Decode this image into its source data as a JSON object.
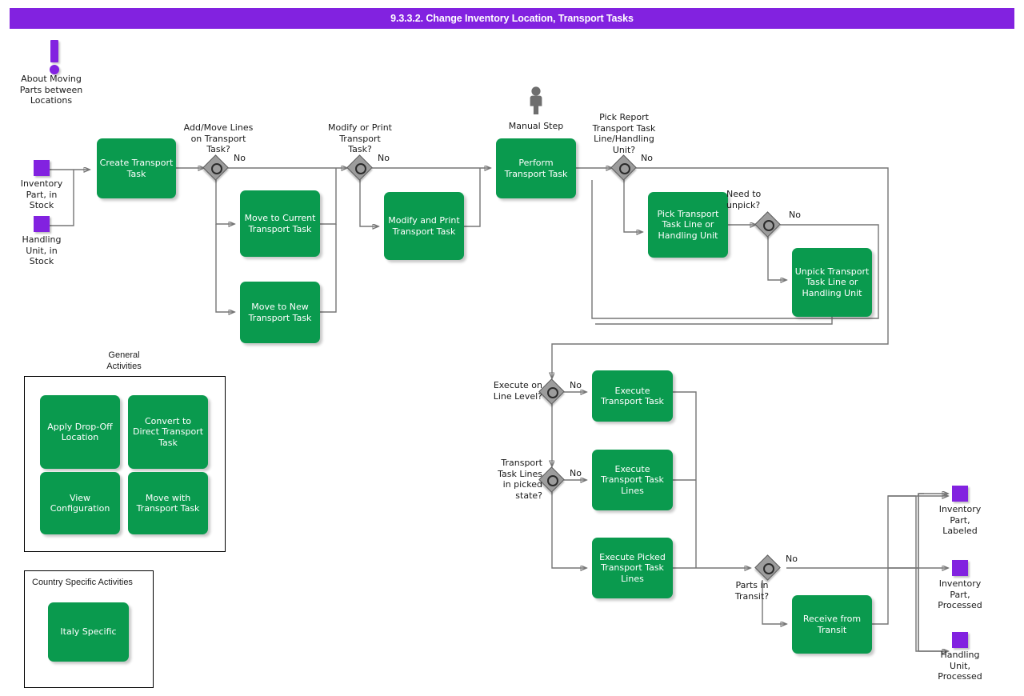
{
  "header": {
    "title": "9.3.3.2. Change Inventory Location, Transport Tasks",
    "background": "#8222e0",
    "text_color": "#ffffff"
  },
  "colors": {
    "activity": "#0a9a4e",
    "data_object": "#8222e0",
    "gateway": "#9c9c9c",
    "connector": "#767676",
    "accent": "#8222e0"
  },
  "annotations": {
    "info_marker": {
      "icon": "exclamation-icon",
      "label": "About Moving\nParts between\nLocations"
    },
    "manual_step": {
      "icon": "person-icon",
      "label": "Manual Step"
    }
  },
  "inputs": [
    {
      "icon": "data-object-icon",
      "label": "Inventory\nPart, in\nStock"
    },
    {
      "icon": "data-object-icon",
      "label": "Handling\nUnit, in\nStock"
    }
  ],
  "outputs": [
    {
      "icon": "data-object-icon",
      "label": "Inventory\nPart,\nLabeled"
    },
    {
      "icon": "data-object-icon",
      "label": "Inventory\nPart,\nProcessed"
    },
    {
      "icon": "data-object-icon",
      "label": "Handling\nUnit,\nProcessed"
    }
  ],
  "activities": [
    {
      "id": "create_transport_task",
      "label": "Create\nTransport Task"
    },
    {
      "id": "move_to_current",
      "label": "Move to\nCurrent\nTransport\nTask"
    },
    {
      "id": "move_to_new",
      "label": "Move to New\nTransport\nTask"
    },
    {
      "id": "modify_and_print",
      "label": "Modify and Print\nTransport Task"
    },
    {
      "id": "perform_transport_task",
      "label": "Perform\nTransport Task"
    },
    {
      "id": "pick_tt_line_or_hu",
      "label": "Pick Transport\nTask Line or\nHandling Unit"
    },
    {
      "id": "unpick_tt_line_or_hu",
      "label": "Unpick\nTransport Task\nLine or Handling\nUnit"
    },
    {
      "id": "execute_transport_task",
      "label": "Execute\nTransport Task"
    },
    {
      "id": "execute_transport_task_lines",
      "label": "Execute\nTransport Task\nLines"
    },
    {
      "id": "execute_picked_tt_lines",
      "label": "Execute Picked\nTransport Task\nLines"
    },
    {
      "id": "receive_from_transit",
      "label": "Receive from\nTransit"
    }
  ],
  "gateways": [
    {
      "id": "gw_add_move_lines",
      "question": "Add/Move Lines\non Transport\nTask?",
      "branch_label": "No"
    },
    {
      "id": "gw_modify_print",
      "question": "Modify or Print\nTransport\nTask?",
      "branch_label": "No"
    },
    {
      "id": "gw_pick_report",
      "question": "Pick Report\nTransport Task\nLine/Handling\nUnit?",
      "branch_label": "No"
    },
    {
      "id": "gw_need_unpick",
      "question": "Need to\nunpick?",
      "branch_label": "No"
    },
    {
      "id": "gw_execute_line",
      "question": "Execute on\nLine Level?",
      "branch_label": "No"
    },
    {
      "id": "gw_lines_picked",
      "question": "Transport\nTask Lines\nin picked\nstate?",
      "branch_label": "No"
    },
    {
      "id": "gw_parts_transit",
      "question": "Parts in\nTransit?",
      "branch_label": "No"
    }
  ],
  "groups": {
    "general": {
      "title": "General\nActivities",
      "items": [
        {
          "id": "apply_drop_off",
          "label": "Apply Drop-Off\nLocation"
        },
        {
          "id": "convert_to_direct",
          "label": "Convert to\nDirect Transport\nTask"
        },
        {
          "id": "view_configuration",
          "label": "View\nConfiguration"
        },
        {
          "id": "move_with_tt",
          "label": "Move with\nTransport Task"
        }
      ]
    },
    "country": {
      "title": "Country Specific Activities",
      "items": [
        {
          "id": "italy_specific",
          "label": "Italy Specific"
        }
      ]
    }
  }
}
